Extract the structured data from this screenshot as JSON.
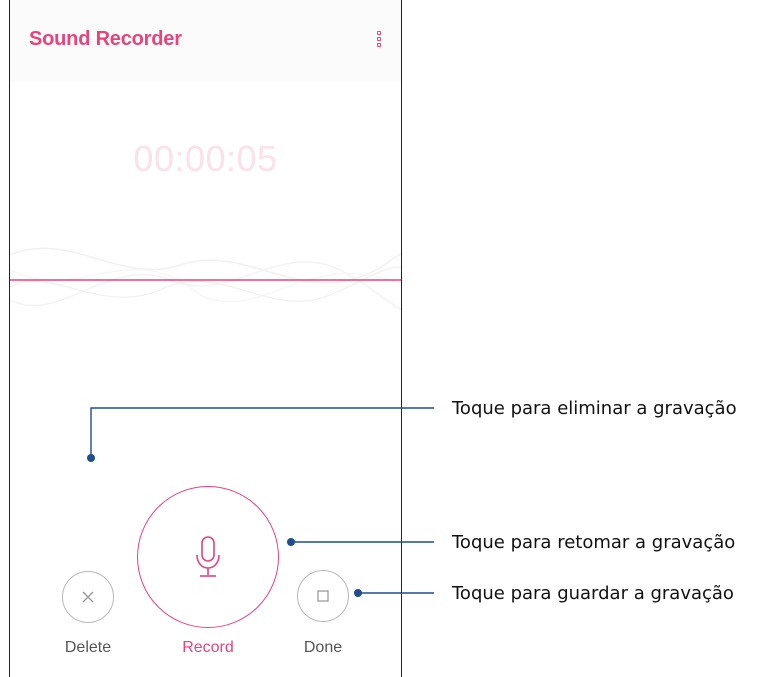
{
  "app": {
    "title": "Sound Recorder",
    "menu_icon": "more-vert-icon",
    "accent_color": "#e8437a"
  },
  "recorder": {
    "elapsed_time": "00:00:05"
  },
  "controls": {
    "delete": {
      "label": "Delete",
      "icon": "close-icon"
    },
    "record": {
      "label": "Record",
      "icon": "microphone-icon"
    },
    "done": {
      "label": "Done",
      "icon": "stop-square-icon"
    }
  },
  "callouts": [
    {
      "text": "Toque para eliminar a gravação",
      "target": "delete"
    },
    {
      "text": "Toque para retomar a gravação",
      "target": "record"
    },
    {
      "text": "Toque para guardar a gravação",
      "target": "done"
    }
  ]
}
